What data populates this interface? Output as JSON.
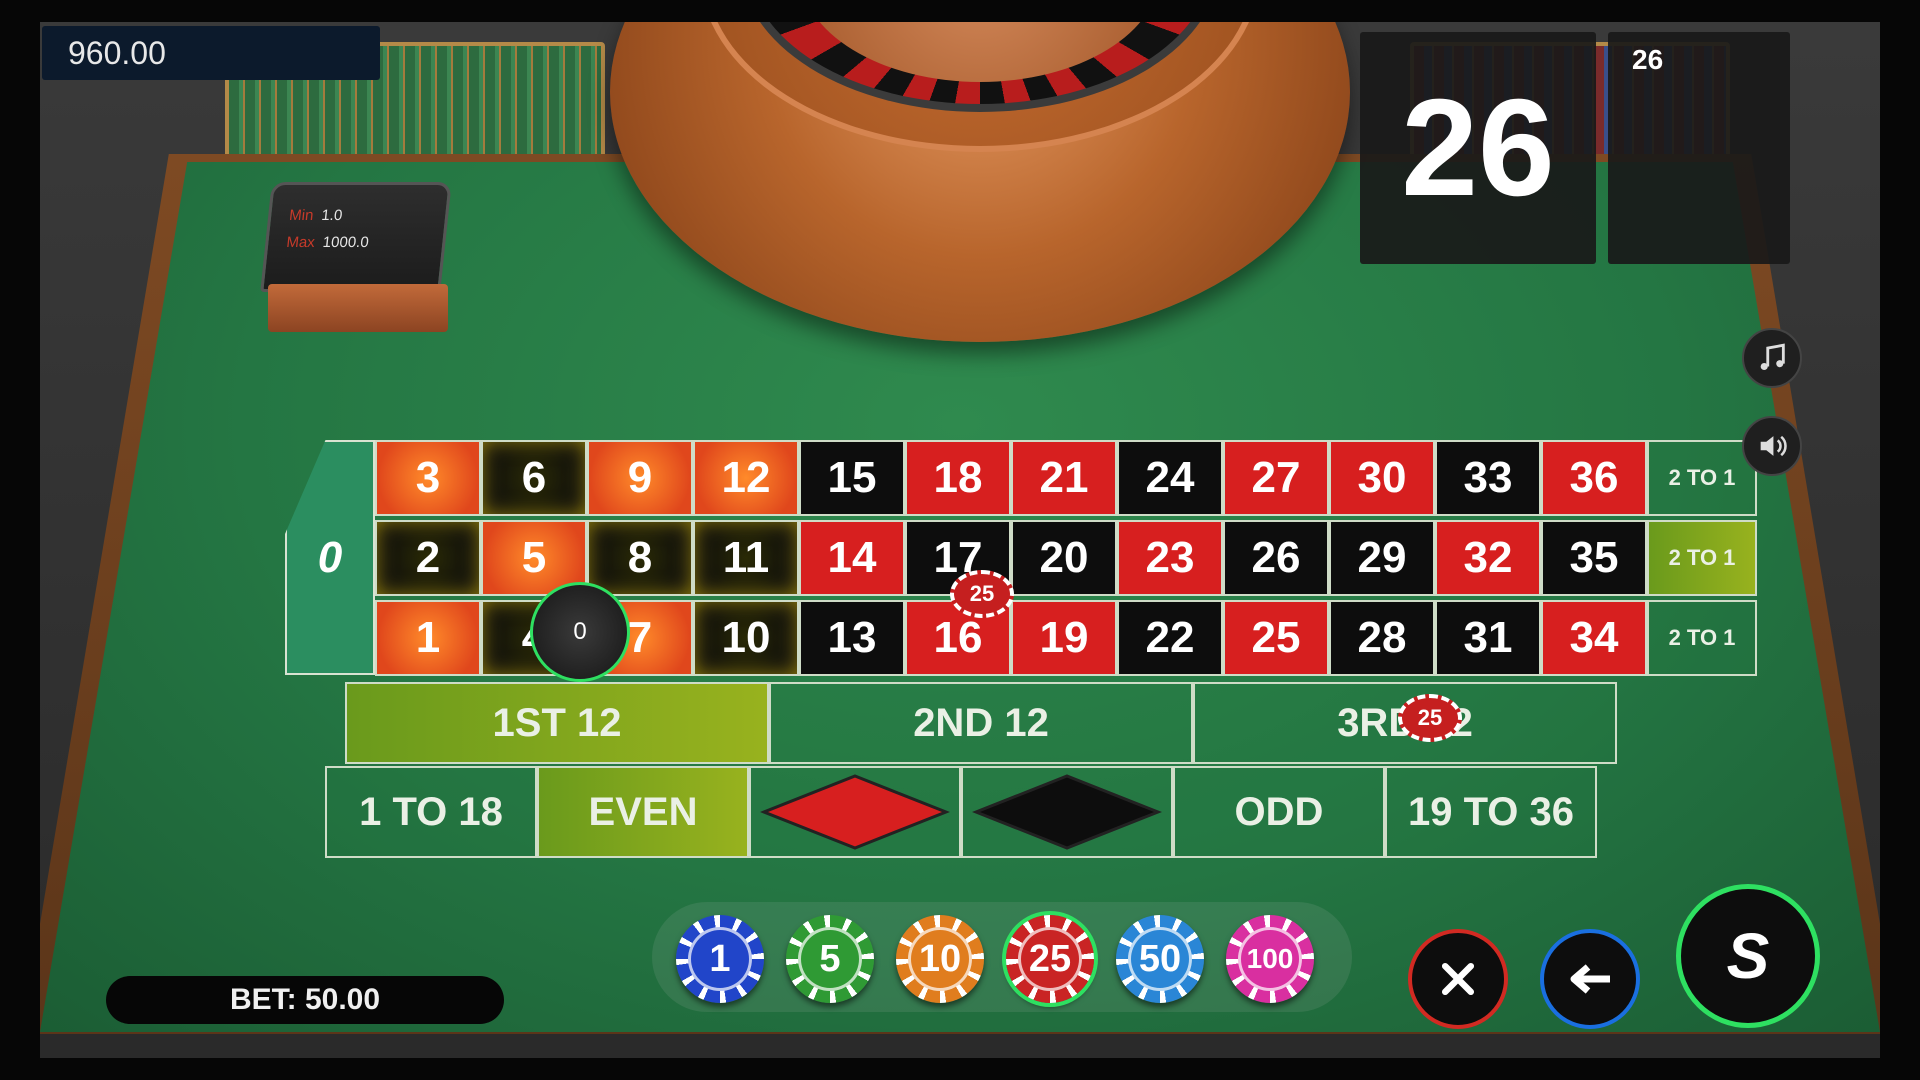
{
  "balance": "960.00",
  "limits": {
    "min_label": "Min",
    "min_value": "1.0",
    "max_label": "Max",
    "max_value": "1000.0"
  },
  "result": {
    "current": "26",
    "history": [
      "26"
    ]
  },
  "board": {
    "zero": "0",
    "rows": [
      [
        {
          "n": "3",
          "c": "hl-red"
        },
        {
          "n": "6",
          "c": "hl-black"
        },
        {
          "n": "9",
          "c": "hl-red"
        },
        {
          "n": "12",
          "c": "hl-red"
        },
        {
          "n": "15",
          "c": "black"
        },
        {
          "n": "18",
          "c": "red"
        },
        {
          "n": "21",
          "c": "red"
        },
        {
          "n": "24",
          "c": "black"
        },
        {
          "n": "27",
          "c": "red"
        },
        {
          "n": "30",
          "c": "red"
        },
        {
          "n": "33",
          "c": "black"
        },
        {
          "n": "36",
          "c": "red"
        }
      ],
      [
        {
          "n": "2",
          "c": "hl-black"
        },
        {
          "n": "5",
          "c": "hl-red"
        },
        {
          "n": "8",
          "c": "hl-black"
        },
        {
          "n": "11",
          "c": "hl-black"
        },
        {
          "n": "14",
          "c": "red"
        },
        {
          "n": "17",
          "c": "black"
        },
        {
          "n": "20",
          "c": "black"
        },
        {
          "n": "23",
          "c": "red"
        },
        {
          "n": "26",
          "c": "black"
        },
        {
          "n": "29",
          "c": "black"
        },
        {
          "n": "32",
          "c": "red"
        },
        {
          "n": "35",
          "c": "black"
        }
      ],
      [
        {
          "n": "1",
          "c": "hl-red"
        },
        {
          "n": "4",
          "c": "hl-black"
        },
        {
          "n": "7",
          "c": "hl-red"
        },
        {
          "n": "10",
          "c": "hl-black"
        },
        {
          "n": "13",
          "c": "black"
        },
        {
          "n": "16",
          "c": "red"
        },
        {
          "n": "19",
          "c": "red"
        },
        {
          "n": "22",
          "c": "black"
        },
        {
          "n": "25",
          "c": "red"
        },
        {
          "n": "28",
          "c": "black"
        },
        {
          "n": "31",
          "c": "black"
        },
        {
          "n": "34",
          "c": "red"
        }
      ]
    ],
    "columns": [
      "2 TO 1",
      "2 TO 1",
      "2 TO 1"
    ],
    "dozens": [
      "1ST 12",
      "2ND 12",
      "3RD 12"
    ],
    "even_money": {
      "low": "1 TO 18",
      "even": "EVEN",
      "odd": "ODD",
      "high": "19 TO 36"
    }
  },
  "placed_chips": [
    {
      "value": "25"
    },
    {
      "value": "25"
    }
  ],
  "zero_chip": "0",
  "chips": [
    {
      "value": "1",
      "color": "#2145c9"
    },
    {
      "value": "5",
      "color": "#2f9a34"
    },
    {
      "value": "10",
      "color": "#e07d1e"
    },
    {
      "value": "25",
      "color": "#c92424"
    },
    {
      "value": "50",
      "color": "#2a86d6"
    },
    {
      "value": "100",
      "color": "#d92fa0"
    }
  ],
  "bet": {
    "label": "BET:",
    "value": "50.00"
  },
  "colors": {
    "felt": "#247643",
    "red": "#d71f1f",
    "black": "#0d0d0d",
    "spin_ring": "#2ee061",
    "clear_ring": "#d22a22",
    "undo_ring": "#1a6fe0"
  },
  "icons": [
    "music-icon",
    "speaker-icon",
    "close-icon",
    "undo-arrow-icon",
    "spin-icon"
  ],
  "spin_label": "S"
}
